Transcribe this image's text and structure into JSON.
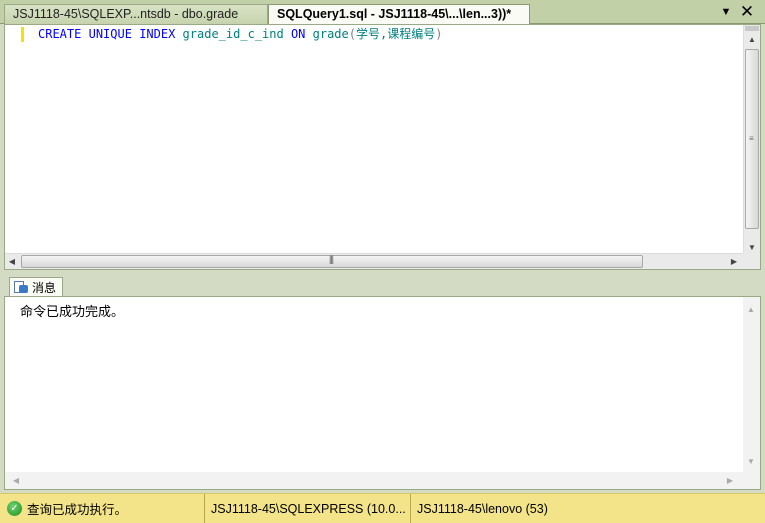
{
  "tabs": {
    "inactive_label": "JSJ1118-45\\SQLEXP...ntsdb - dbo.grade",
    "active_label": "SQLQuery1.sql - JSJ1118-45\\...\\len...3))*",
    "menu_icon": "dropdown-arrow-icon",
    "close_icon": "close-icon"
  },
  "editor": {
    "kw_create": "CREATE",
    "kw_unique": "UNIQUE",
    "kw_index": "INDEX",
    "index_name": "grade_id_c_ind",
    "kw_on": "ON",
    "table_name": "grade",
    "open_paren": "(",
    "columns": "学号,课程编号",
    "close_paren": ")",
    "colors": {
      "keyword": "#0000ff",
      "identifier": "#008080",
      "paren": "#808080"
    }
  },
  "results": {
    "tab_label": "消息",
    "message": "命令已成功完成。"
  },
  "statusbar": {
    "status_text": "查询已成功执行。",
    "server": "JSJ1118-45\\SQLEXPRESS (10.0...",
    "user": "JSJ1118-45\\lenovo (53)"
  }
}
